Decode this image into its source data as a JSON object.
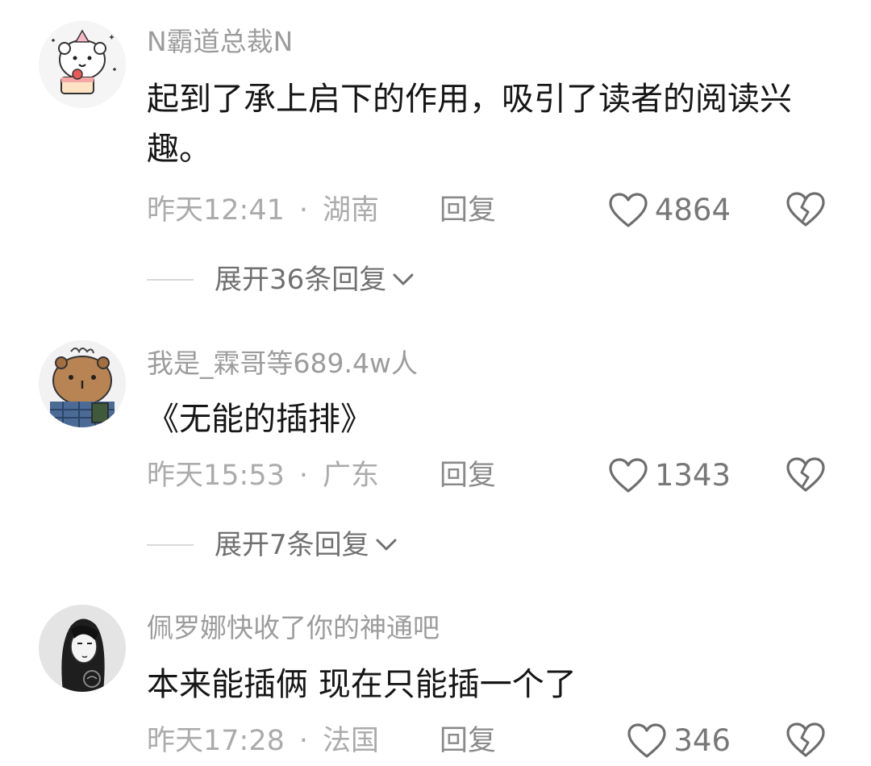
{
  "comments": [
    {
      "username": "N霸道总裁N",
      "avatar_icon": "white-bear-cake-avatar",
      "content": "起到了承上启下的作用，吸引了读者的阅读兴趣。",
      "time": "昨天12:41",
      "location": "湖南",
      "reply_label": "回复",
      "like_count": "4864",
      "expand_label": "展开36条回复"
    },
    {
      "username": "我是_霖哥等689.4w人",
      "avatar_icon": "capybara-avatar",
      "content": "《无能的插排》",
      "time": "昨天15:53",
      "location": "广东",
      "reply_label": "回复",
      "like_count": "1343",
      "expand_label": "展开7条回复"
    },
    {
      "username": "佩罗娜快收了你的神通吧",
      "avatar_icon": "sketch-girl-avatar",
      "content": "本来能插俩 现在只能插一个了",
      "time": "昨天17:28",
      "location": "法国",
      "reply_label": "回复",
      "like_count": "346"
    }
  ],
  "separator": "·",
  "colors": {
    "username": "#9c9c9c",
    "content": "#161616",
    "meta": "#ababab",
    "icon": "#6e6e6e"
  }
}
